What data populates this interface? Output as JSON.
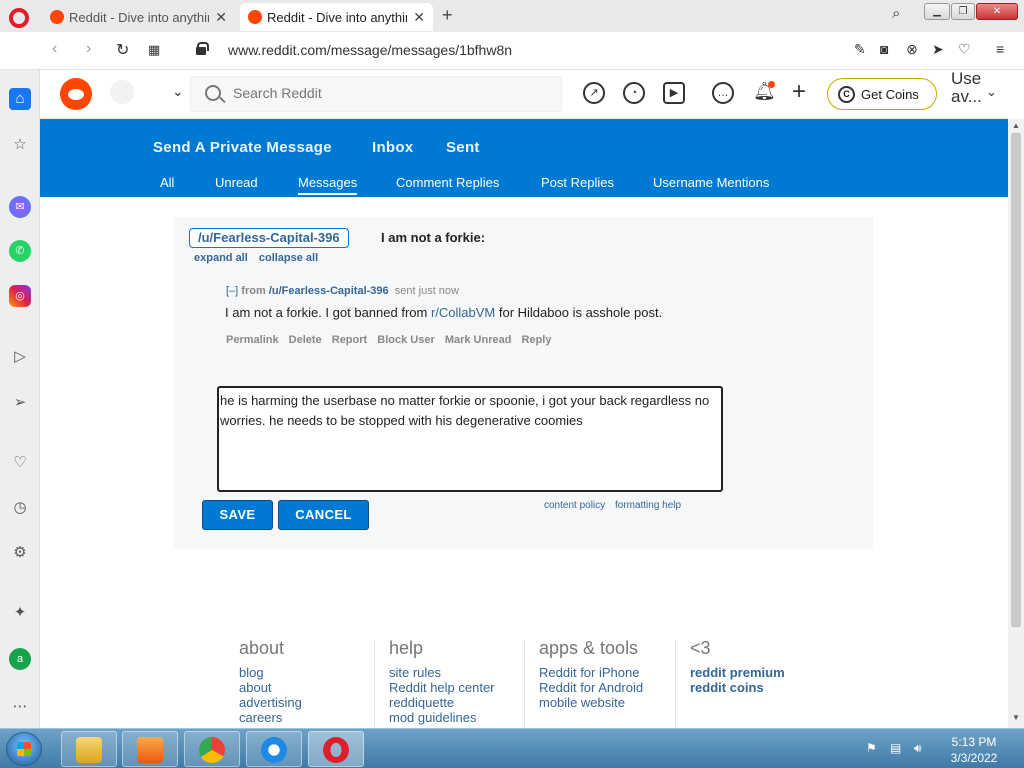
{
  "browser": {
    "tabs": [
      {
        "title": "Reddit - Dive into anything",
        "active": false
      },
      {
        "title": "Reddit - Dive into anything",
        "active": true
      }
    ],
    "url": "www.reddit.com/message/messages/1bfhw8n"
  },
  "header": {
    "search_placeholder": "Search Reddit",
    "get_coins_label": "Get Coins",
    "user_text": "Use\nav..."
  },
  "nav": {
    "top": [
      "Send A Private Message",
      "Inbox",
      "Sent"
    ],
    "sub": [
      "All",
      "Unread",
      "Messages",
      "Comment Replies",
      "Post Replies",
      "Username Mentions"
    ],
    "active_sub": "Messages"
  },
  "message": {
    "to_user": "/u/Fearless-Capital-396",
    "subject": "I am not a forkie:",
    "expand_all": "expand all",
    "collapse_all": "collapse all",
    "toggle": "[–]",
    "from_label": "from",
    "author": "/u/Fearless-Capital-396",
    "sent": "sent just now",
    "body_before": "I am not a forkie. I got banned from ",
    "body_link": "r/CollabVM",
    "body_after": " for Hildaboo is asshole post.",
    "actions": [
      "Permalink",
      "Delete",
      "Report",
      "Block User",
      "Mark Unread",
      "Reply"
    ],
    "reply_text": "he is harming the userbase no matter forkie or spoonie, i got your back regardless no worries. he needs to be stopped with his degenerative coomies",
    "save_label": "SAVE",
    "cancel_label": "CANCEL",
    "content_policy": "content policy",
    "formatting_help": "formatting help"
  },
  "footer": {
    "cols": [
      {
        "heading": "about",
        "links": [
          "blog",
          "about",
          "advertising",
          "careers"
        ]
      },
      {
        "heading": "help",
        "links": [
          "site rules",
          "Reddit help center",
          "reddiquette",
          "mod guidelines"
        ]
      },
      {
        "heading": "apps & tools",
        "links": [
          "Reddit for iPhone",
          "Reddit for Android",
          "mobile website"
        ]
      },
      {
        "heading": "<3",
        "links": [
          "reddit premium",
          "reddit coins"
        ]
      }
    ]
  },
  "taskbar": {
    "time": "5:13 PM",
    "date": "3/3/2022"
  },
  "colors": {
    "reddit_orange": "#ff4500",
    "nav_blue": "#0079d3",
    "link_blue": "#336699"
  }
}
